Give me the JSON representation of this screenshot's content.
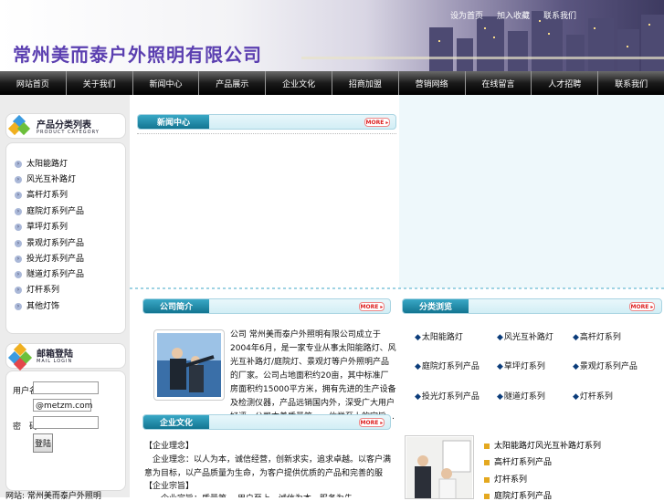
{
  "header": {
    "company_name": "常州美而泰户外照明有限公司",
    "top_links": [
      "设为首页",
      "加入收藏",
      "联系我们"
    ]
  },
  "nav": {
    "items": [
      "网站首页",
      "关于我们",
      "新闻中心",
      "产品展示",
      "企业文化",
      "招商加盟",
      "营销网络",
      "在线留言",
      "人才招聘",
      "联系我们"
    ]
  },
  "sidebar": {
    "category_title": "产品分类列表",
    "category_subtitle": "PRODUCT CATEGORY",
    "categories": [
      "太阳能路灯",
      "风光互补路灯",
      "高杆灯系列",
      "庭院灯系列产品",
      "草坪灯系列",
      "景观灯系列产品",
      "投光灯系列产品",
      "隧道灯系列产品",
      "灯杆系列",
      "其他灯饰"
    ],
    "mail_title": "邮箱登陆",
    "mail_subtitle": "MAIL LOGIN",
    "user_label": "用户名：",
    "domain_value": "@metzm.com",
    "password_label": "密　码：",
    "login_label": "登陆",
    "footer_text": "网站: 常州美而泰户外照明"
  },
  "news": {
    "title": "新闻中心",
    "more": "MORE"
  },
  "about": {
    "title": "公司简介",
    "more": "MORE",
    "text": "公司 常州美而泰户外照明有限公司成立于2004年6月，是一家专业从事太阳能路灯、风光互补路灯/庭院灯、景观灯等户外照明产品的厂家。公司占地面积约20亩，其中标准厂房面积约15000平方米，拥有先进的生产设备及检测仪器，产品远销国内外，深受广大用户好评，公司本着质量第一、信誉至上的宗旨…"
  },
  "classify": {
    "title": "分类浏览",
    "more": "MORE",
    "items": [
      "太阳能路灯",
      "风光互补路灯",
      "高杆灯系列",
      "庭院灯系列产品",
      "草坪灯系列",
      "景观灯系列产品",
      "投光灯系列产品",
      "隧道灯系列",
      "灯杆系列"
    ]
  },
  "culture": {
    "title": "企业文化",
    "more": "MORE",
    "heading1": "【企业理念】",
    "text1": "　企业理念：以人为本，诚信经营，创新求实，追求卓越。以客户满意为目标，以产品质量为生命，为客户提供优质的产品和完善的服务，与客户共同发展，共创美好未来。",
    "heading2": "【企业宗旨】",
    "text2": "　　企业宗旨：质量第一 用户至上，诚信为本，服务为先"
  },
  "products": {
    "items": [
      "太阳能路灯风光互补路灯系列",
      "高杆灯系列产品",
      "灯杆系列",
      "庭院灯系列产品"
    ]
  }
}
